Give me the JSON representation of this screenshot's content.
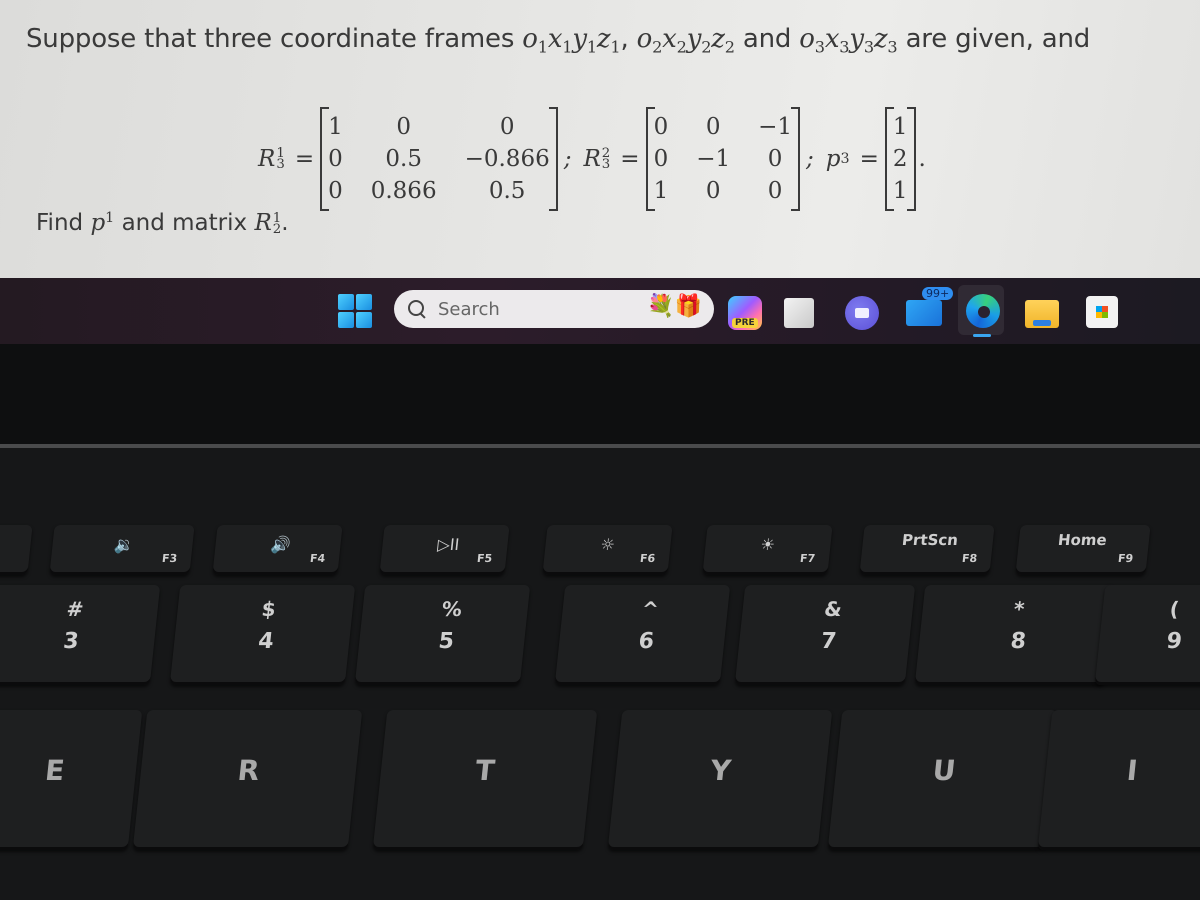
{
  "problem": {
    "intro_text": "Suppose that three coordinate frames",
    "frames": [
      {
        "name": "o",
        "x": "x",
        "y": "y",
        "z": "z",
        "index": "1"
      },
      {
        "name": "o",
        "x": "x",
        "y": "y",
        "z": "z",
        "index": "2"
      },
      {
        "name": "o",
        "x": "x",
        "y": "y",
        "z": "z",
        "index": "3"
      }
    ],
    "separator_comma": ",",
    "and_1": "and",
    "intro_tail": "are given, and",
    "matrices": [
      {
        "symbol": "R",
        "sup": "1",
        "sub": "3",
        "equals": "=",
        "rows": [
          [
            "1",
            "0",
            "0"
          ],
          [
            "0",
            "0.5",
            "−0.866"
          ],
          [
            "0",
            "0.866",
            "0.5"
          ]
        ],
        "separator": ";"
      },
      {
        "symbol": "R",
        "sup": "2",
        "sub": "3",
        "equals": "=",
        "rows": [
          [
            "0",
            "0",
            "−1"
          ],
          [
            "0",
            "−1",
            "0"
          ],
          [
            "1",
            "0",
            "0"
          ]
        ],
        "separator": ";"
      }
    ],
    "vector": {
      "symbol": "p",
      "sup": "3",
      "equals": "=",
      "values": [
        "1",
        "2",
        "1"
      ],
      "terminator": "."
    },
    "question": {
      "find": "Find",
      "p_symbol": "p",
      "p_sup": "1",
      "and_matrix": "and matrix",
      "R_symbol": "R",
      "R_sup": "1",
      "R_sub": "2",
      "end": "."
    }
  },
  "taskbar": {
    "search_placeholder": "Search",
    "search_decoration": "💐🎁",
    "copilot_badge": "PRE",
    "mail_badge": "99+",
    "icons": [
      "windows-start-icon",
      "search-icon",
      "copilot-icon",
      "task-view-icon",
      "teams-meet-icon",
      "mail-icon",
      "edge-icon",
      "file-explorer-icon",
      "store-icon"
    ]
  },
  "keyboard": {
    "function_row": [
      {
        "glyph": "🔉",
        "label": "F3"
      },
      {
        "glyph": "🔊",
        "label": "F4"
      },
      {
        "glyph": "▷II",
        "label": "F5"
      },
      {
        "glyph": "☼",
        "label": "F6"
      },
      {
        "glyph": "☀",
        "label": "F7"
      },
      {
        "word": "PrtScn",
        "label": "F8"
      },
      {
        "word": "Home",
        "label": "F9"
      }
    ],
    "number_row": [
      {
        "shift": "#",
        "main": "3"
      },
      {
        "shift": "$",
        "main": "4"
      },
      {
        "shift": "%",
        "main": "5"
      },
      {
        "shift": "^",
        "main": "6"
      },
      {
        "shift": "&",
        "main": "7"
      },
      {
        "shift": "*",
        "main": "8"
      },
      {
        "shift": "(",
        "main": "9"
      }
    ],
    "alpha_row": [
      "E",
      "R",
      "T",
      "Y",
      "U",
      "I"
    ]
  }
}
